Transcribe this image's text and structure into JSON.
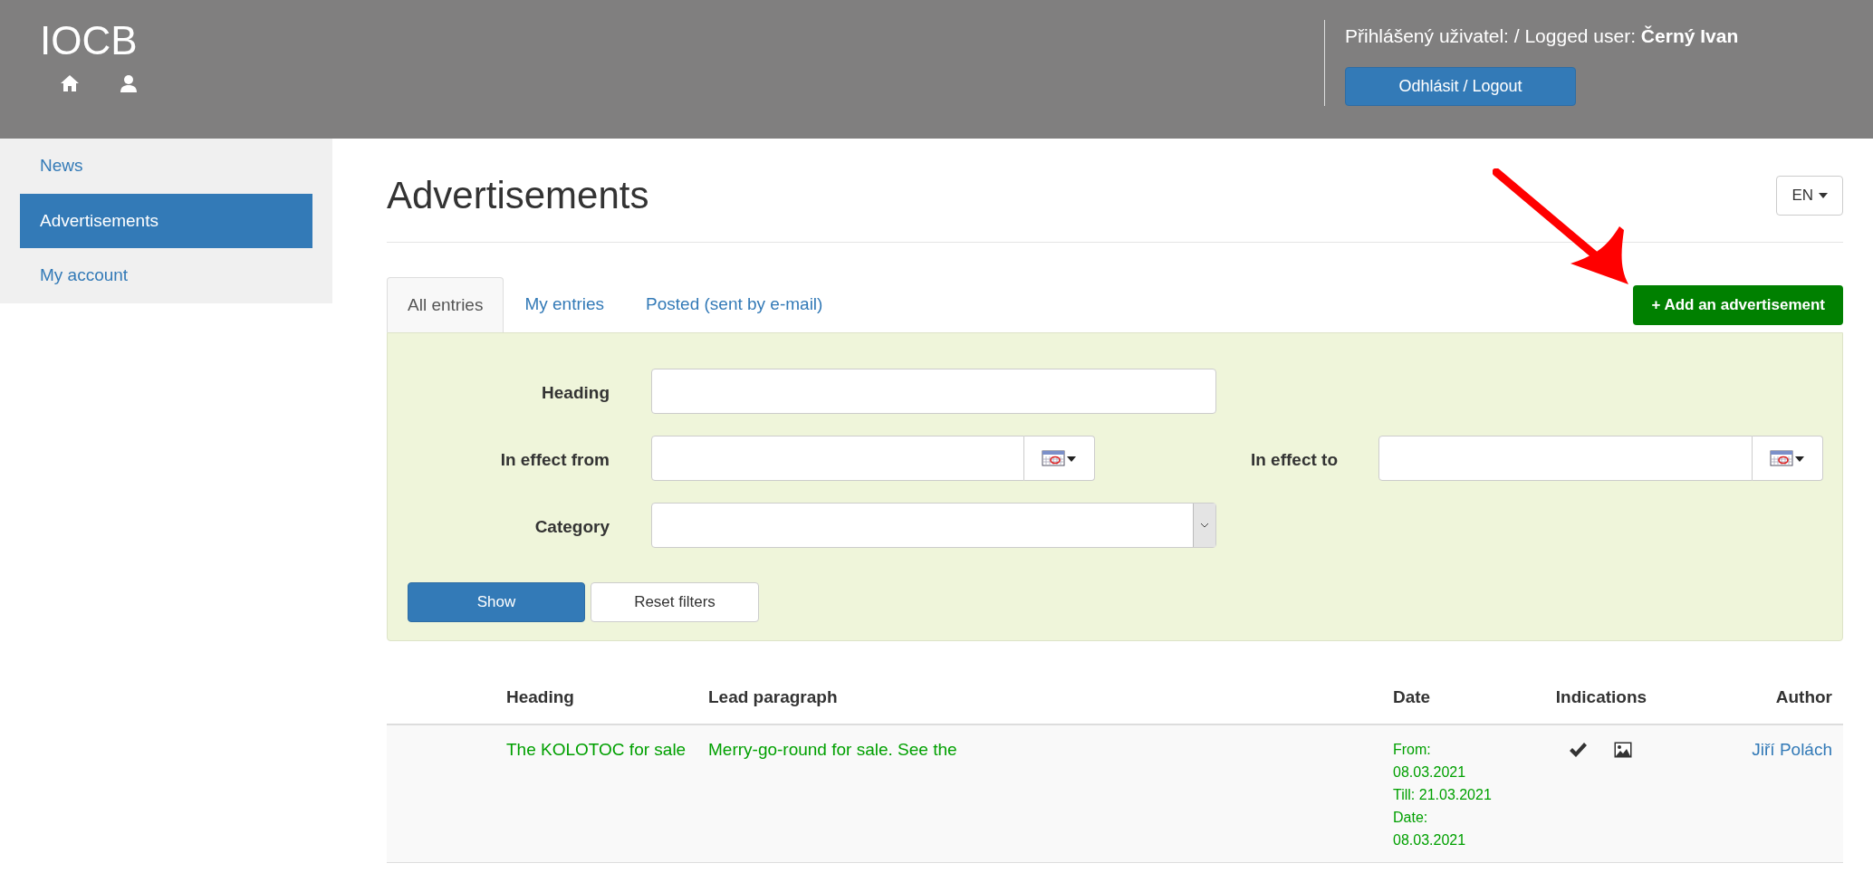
{
  "header": {
    "logo": "IOCB",
    "user_label": "Přihlášený uživatel: / Logged user:",
    "user_name": "Černý Ivan",
    "logout": "Odhlásit / Logout"
  },
  "sidebar": {
    "items": [
      {
        "label": "News",
        "selected": false
      },
      {
        "label": "Advertisements",
        "selected": true
      },
      {
        "label": "My account",
        "selected": false
      }
    ]
  },
  "page": {
    "title": "Advertisements",
    "language": "EN"
  },
  "tabs": [
    {
      "label": "All entries",
      "selected": true
    },
    {
      "label": "My entries",
      "selected": false
    },
    {
      "label": "Posted (sent by e-mail)",
      "selected": false
    }
  ],
  "add_button": "+ Add an advertisement",
  "filters": {
    "heading": {
      "label": "Heading"
    },
    "in_effect_from": {
      "label": "In effect from"
    },
    "in_effect_to": {
      "label": "In effect to"
    },
    "category": {
      "label": "Category"
    },
    "show_button": "Show",
    "reset_button": "Reset filters"
  },
  "table": {
    "columns": [
      "Heading",
      "Lead paragraph",
      "Date",
      "Indications",
      "Author"
    ],
    "rows": [
      {
        "heading": "The KOLOTOC for sale",
        "lead": "Merry-go-round for sale. See the",
        "date_lines": [
          "From:",
          "08.03.2021",
          "Till: 21.03.2021",
          "Date:",
          "08.03.2021"
        ],
        "indications": [
          {
            "kind": "check"
          },
          {
            "kind": "image"
          }
        ],
        "author": "Jiří Polách"
      }
    ]
  }
}
